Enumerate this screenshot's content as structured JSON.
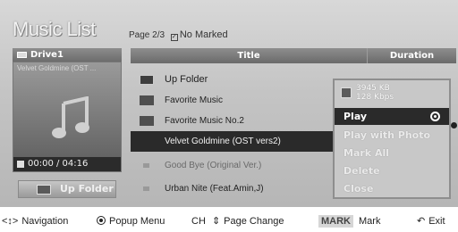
{
  "header": {
    "title": "Music List",
    "page": "Page 2/3",
    "marked": "No Marked"
  },
  "left_panel": {
    "drive": "Drive1",
    "subtitle": "Velvet Goldmine (OST ...",
    "time": "00:00 / 04:16",
    "up_folder_button": "Up Folder"
  },
  "list": {
    "columns": {
      "title": "Title",
      "duration": "Duration"
    },
    "rows": [
      {
        "label": "Up Folder",
        "icon": "up-folder-icon"
      },
      {
        "label": "Favorite Music",
        "icon": "folder-icon"
      },
      {
        "label": "Favorite Music No.2",
        "icon": "folder-icon"
      },
      {
        "label": "Velvet Goldmine (OST vers2)",
        "icon": "music-file-icon"
      },
      {
        "label": "Good Bye (Original Ver.)",
        "icon": "music-file-icon"
      },
      {
        "label": "Urban Nite (Feat.Amin,J)",
        "icon": "music-file-icon"
      }
    ]
  },
  "popup": {
    "size": "3945 KB",
    "bitrate": "128 Kbps",
    "items": [
      "Play",
      "Play with Photo",
      "Mark All",
      "Delete",
      "Close"
    ]
  },
  "footer": {
    "navigation": "Navigation",
    "popup_menu": "Popup Menu",
    "ch": "CH",
    "page_change": "Page Change",
    "mark_key": "MARK",
    "mark": "Mark",
    "exit": "Exit"
  },
  "colors": {
    "selected_bg": "#2a2a2a",
    "header_bg": "#7a7a7a",
    "screen_bg": "#c4c4c4"
  }
}
